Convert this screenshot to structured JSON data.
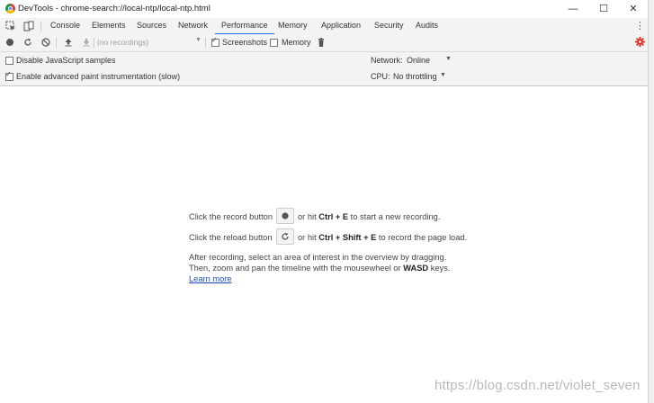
{
  "window": {
    "title": "DevTools - chrome-search://local-ntp/local-ntp.html",
    "minimize": "—",
    "maximize": "☐",
    "close": "✕"
  },
  "tabs": [
    {
      "label": "Console",
      "active": false
    },
    {
      "label": "Elements",
      "active": false
    },
    {
      "label": "Sources",
      "active": false
    },
    {
      "label": "Network",
      "active": false
    },
    {
      "label": "Performance",
      "active": true
    },
    {
      "label": "Memory",
      "active": false
    },
    {
      "label": "Application",
      "active": false
    },
    {
      "label": "Security",
      "active": false
    },
    {
      "label": "Audits",
      "active": false
    }
  ],
  "toolbar": {
    "recordings_placeholder": "(no recordings)",
    "screenshots_label": "Screenshots",
    "screenshots_checked": true,
    "memory_label": "Memory",
    "memory_checked": false,
    "accent_color": "#d93025"
  },
  "settings": {
    "disable_js_label": "Disable JavaScript samples",
    "disable_js_checked": false,
    "paint_label": "Enable advanced paint instrumentation (slow)",
    "paint_checked": true,
    "network_label": "Network:",
    "network_value": "Online",
    "cpu_label": "CPU:",
    "cpu_value": "No throttling"
  },
  "landing": {
    "record_prefix": "Click the record button",
    "record_mid": "or hit",
    "record_keys": "Ctrl + E",
    "record_suffix": "to start a new recording.",
    "reload_prefix": "Click the reload button",
    "reload_mid": "or hit",
    "reload_keys": "Ctrl + Shift + E",
    "reload_suffix": "to record the page load.",
    "after_line1": "After recording, select an area of interest in the overview by dragging.",
    "after_line2_prefix": "Then, zoom and pan the timeline with the mousewheel or",
    "after_line2_keys": "WASD",
    "after_line2_suffix": "keys.",
    "learn_more": "Learn more"
  },
  "watermark": "https://blog.csdn.net/violet_seven"
}
